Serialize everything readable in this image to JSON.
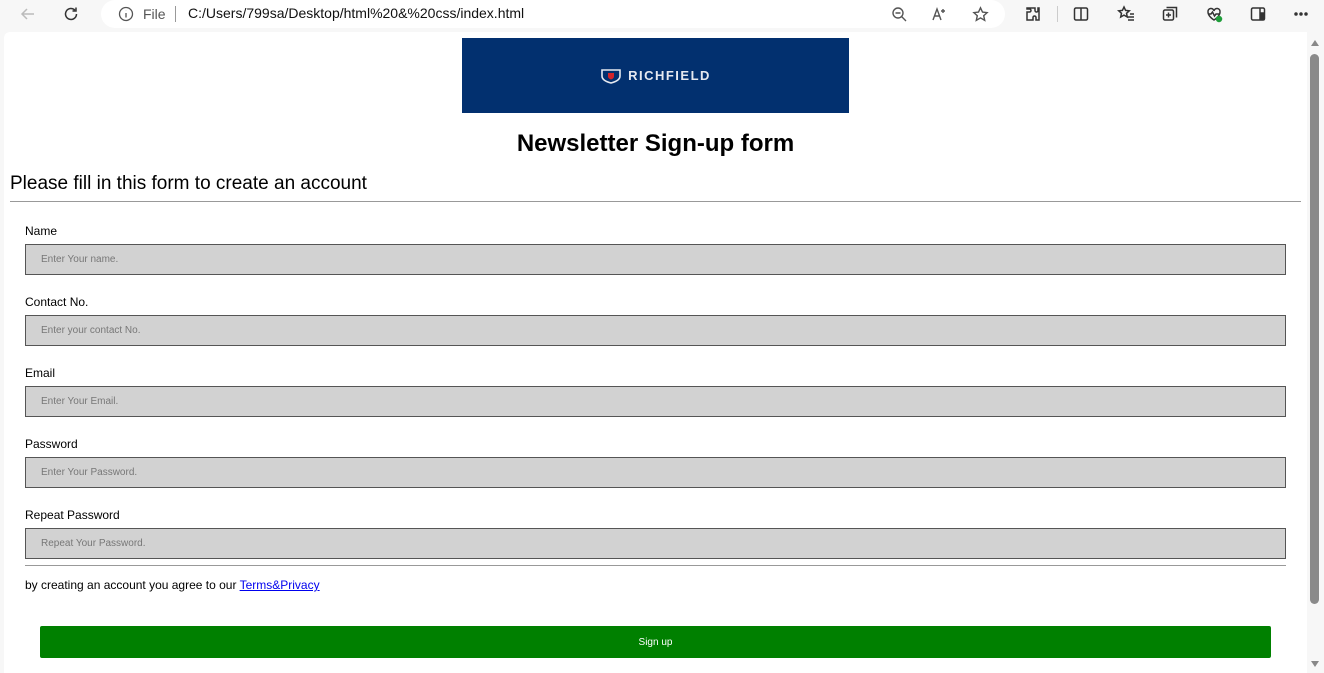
{
  "browser": {
    "address_prefix": "File",
    "url": "C:/Users/799sa/Desktop/html%20&%20css/index.html",
    "icons": [
      "back-icon",
      "refresh-icon",
      "info-icon",
      "zoom-out-icon",
      "read-aloud-icon",
      "favorite-star-icon",
      "extensions-icon",
      "split-screen-icon",
      "favorites-icon",
      "collections-icon",
      "browser-essentials-icon",
      "sidebar-icon",
      "more-icon"
    ]
  },
  "page": {
    "logo_text": "RICHFIELD",
    "title": "Newsletter Sign-up form",
    "subtitle": "Please fill in this form to create an account",
    "fields": [
      {
        "label": "Name",
        "placeholder": "Enter Your name."
      },
      {
        "label": "Contact No.",
        "placeholder": "Enter your contact No."
      },
      {
        "label": "Email",
        "placeholder": "Enter Your Email."
      },
      {
        "label": "Password",
        "placeholder": "Enter Your Password."
      },
      {
        "label": "Repeat Password",
        "placeholder": "Repeat Your Password."
      }
    ],
    "terms_text": "by creating an account you agree to our ",
    "terms_link": "Terms&Privacy",
    "signup_label": "Sign up"
  },
  "colors": {
    "logo_bg": "#02306f",
    "signup_bg": "#008000",
    "input_bg": "#d2d2d2",
    "link": "#0000ee"
  }
}
